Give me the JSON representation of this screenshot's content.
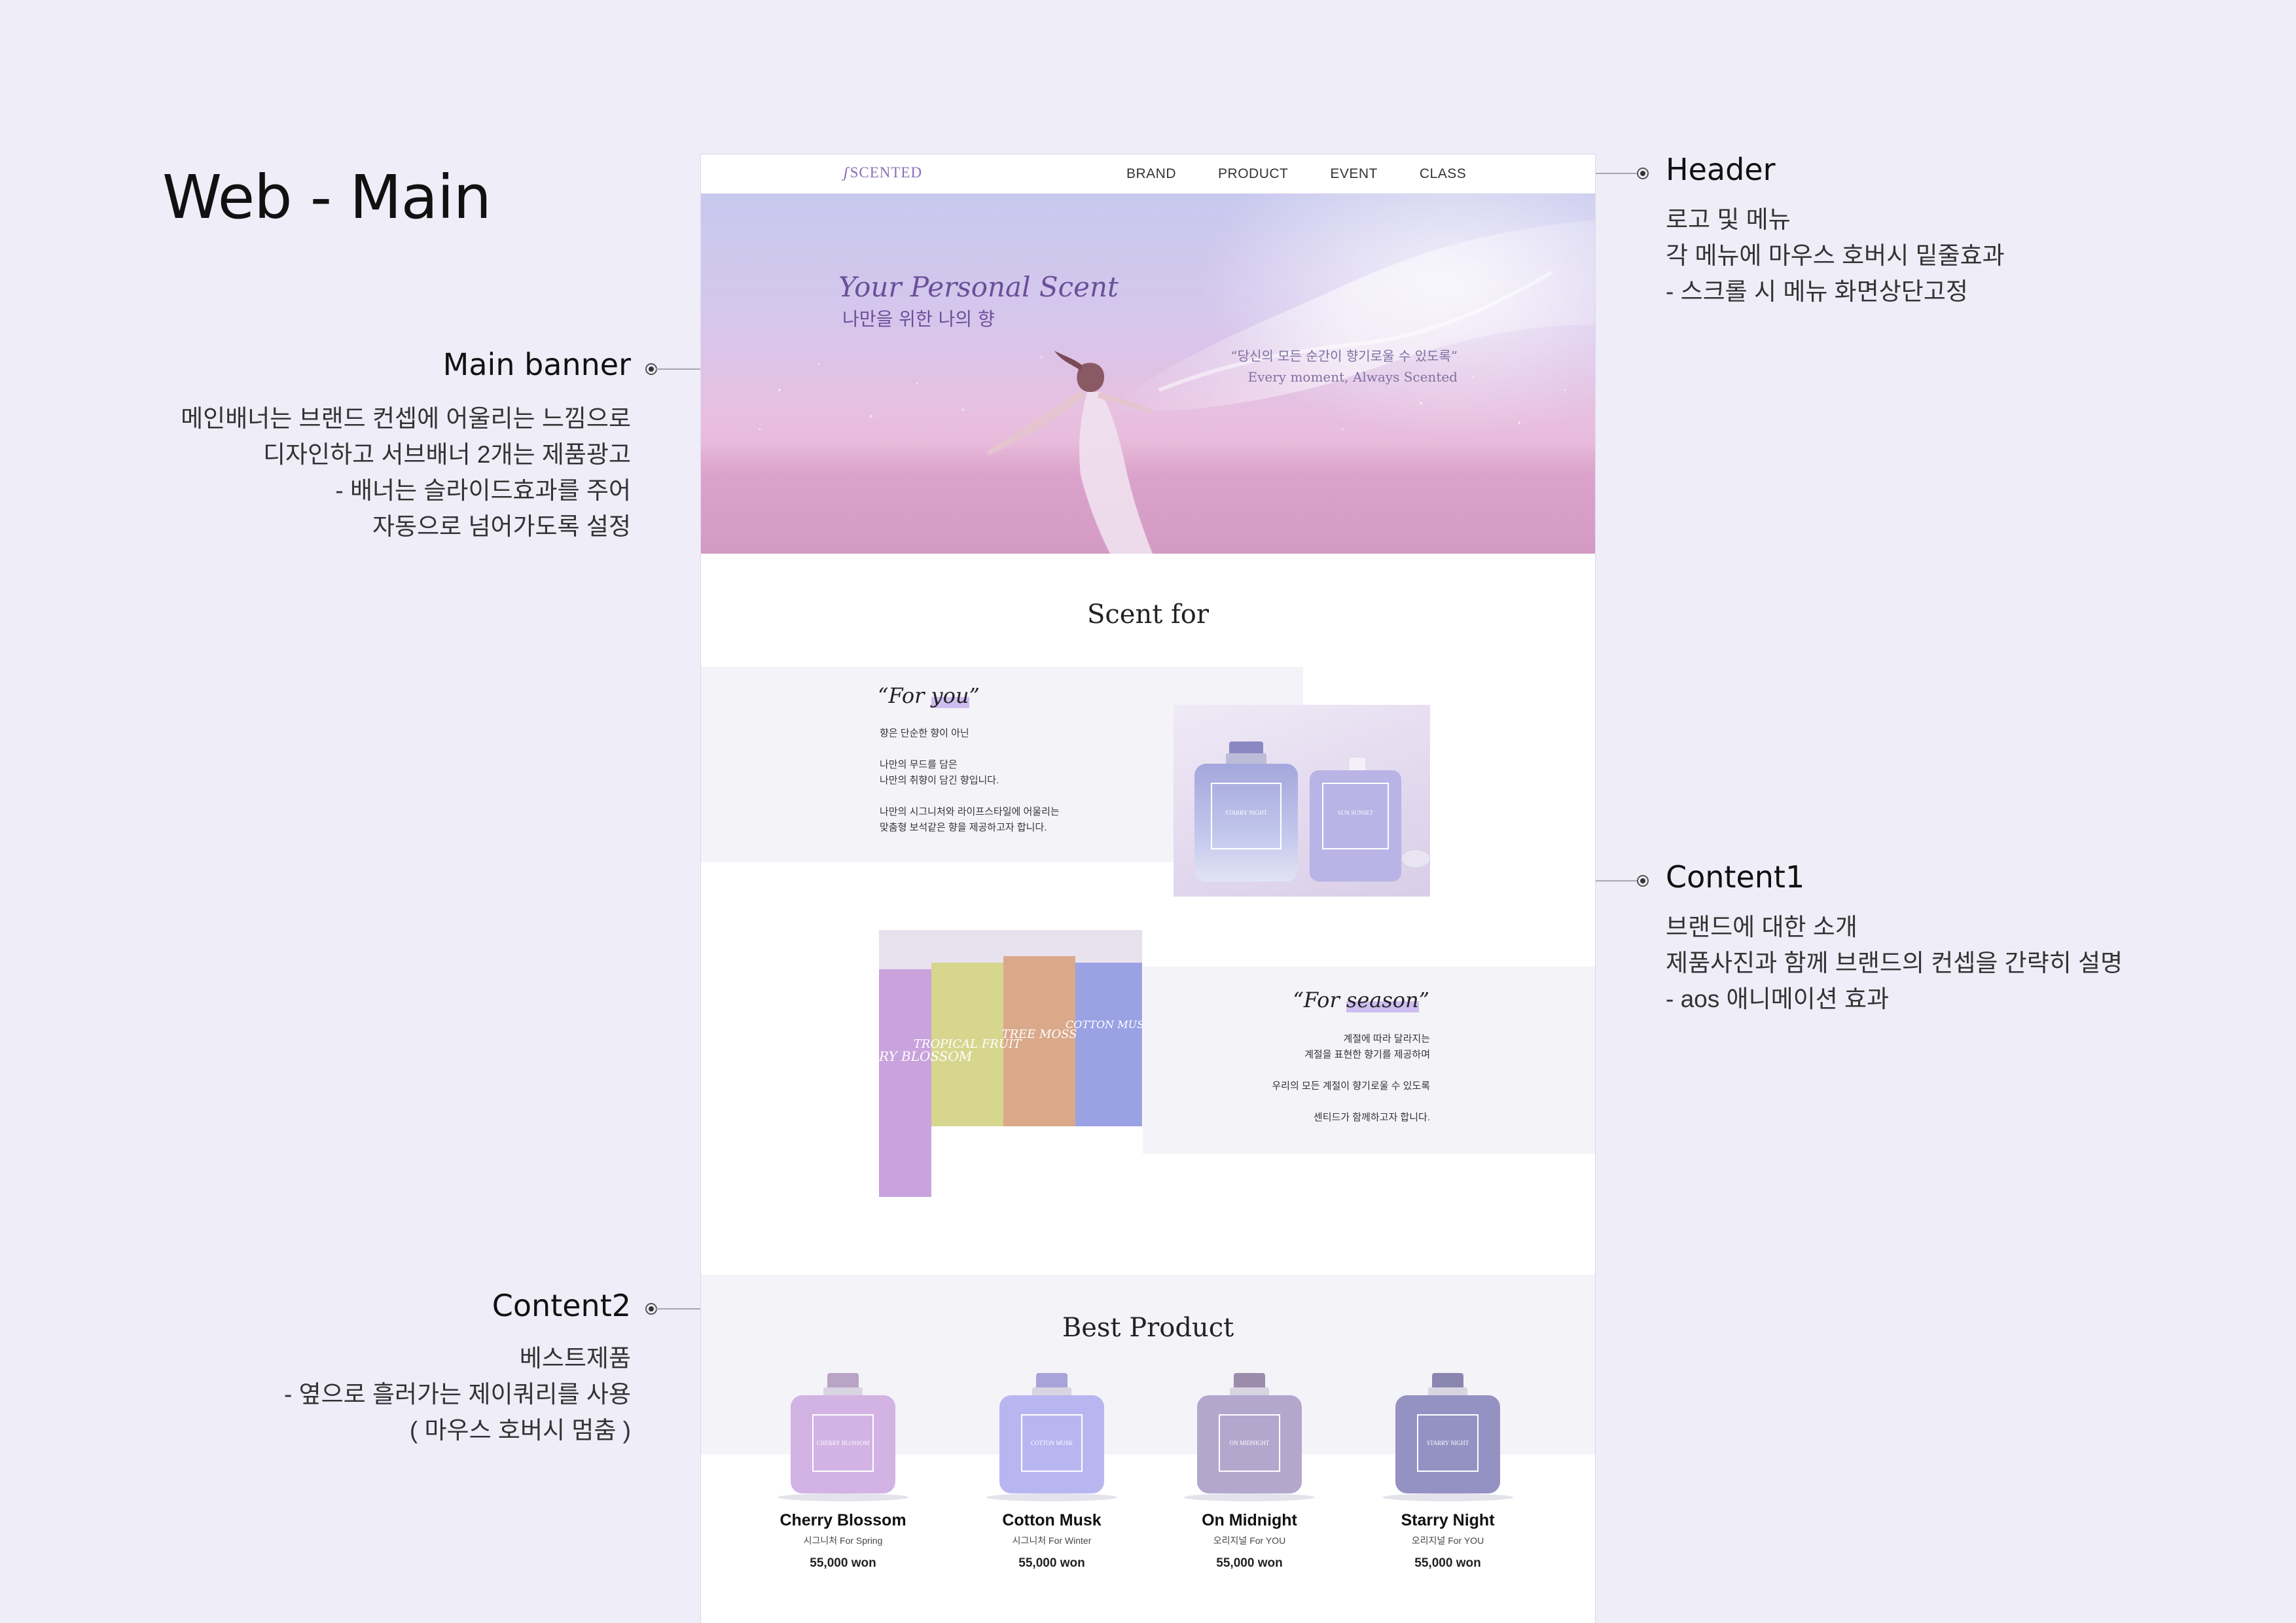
{
  "page": {
    "title": "Web - Main"
  },
  "annotations": {
    "header": {
      "title": "Header",
      "lines": [
        "로고 및 메뉴",
        "각 메뉴에 마우스 호버시 밑줄효과",
        "- 스크롤 시 메뉴 화면상단고정"
      ]
    },
    "main_banner": {
      "title": "Main banner",
      "lines": [
        "메인배너는 브랜드 컨셉에 어울리는 느낌으로",
        "디자인하고 서브배너 2개는 제품광고",
        "- 배너는 슬라이드효과를 주어",
        "자동으로 넘어가도록 설정"
      ]
    },
    "content1": {
      "title": "Content1",
      "lines": [
        "브랜드에 대한 소개",
        "제품사진과 함께 브랜드의 컨셉을 간략히 설명",
        "- aos 애니메이션 효과"
      ]
    },
    "content2": {
      "title": "Content2",
      "lines": [
        "베스트제품",
        "- 옆으로 흘러가는 제이쿼리를 사용",
        "( 마우스 호버시 멈춤 )"
      ]
    }
  },
  "site": {
    "logo": "SCENTED",
    "nav": [
      "BRAND",
      "PRODUCT",
      "EVENT",
      "CLASS"
    ],
    "banner": {
      "headline": "Your Personal Scent",
      "subheadline": "나만을 위한 나의 향",
      "quote_ko": "“당신의 모든 순간이 향기로울 수 있도록”",
      "quote_en": "Every moment, Always Scented"
    },
    "scent_for": {
      "title": "Scent for",
      "for_you": {
        "title_prefix": "“For ",
        "title_highlight": "you",
        "title_suffix": "”",
        "paragraphs": [
          "향은 단순한 향이 아닌",
          "나만의 무드를 담은",
          "나만의 취향이 담긴 향입니다.",
          "나만의 시그니처와 라이프스타일에 어울리는",
          "맞춤형 보석같은 향을 제공하고자 합니다."
        ]
      },
      "for_season": {
        "title_prefix": "“For ",
        "title_highlight": "season",
        "title_suffix": "”",
        "paragraphs": [
          "계절에 따라 달라지는",
          "계절을 표현한 향기를 제공하며",
          "우리의 모든 계절이 향기로울 수 있도록",
          "센티드가 함께하고자 합니다."
        ]
      },
      "bottle_labels": [
        "STARRY NIGHT",
        "SUN SUNSET"
      ],
      "box_labels": [
        "CHERRY BLOSSOM",
        "TROPICAL FRUIT",
        "TREE MOSS",
        "COTTON MUSK"
      ]
    },
    "best_product": {
      "title": "Best Product",
      "items": [
        {
          "name": "Cherry Blossom",
          "sub": "시그니처 For Spring",
          "price": "55,000 won",
          "label": "CHERRY BLOSSOM",
          "color": "#c9a3dd",
          "cap": "#b8a4c4"
        },
        {
          "name": "Cotton Musk",
          "sub": "시그니처 For Winter",
          "price": "55,000 won",
          "label": "COTTON MUSK",
          "color": "#a9a7ee",
          "cap": "#a8a3d8"
        },
        {
          "name": "On Midnight",
          "sub": "오리지널 For YOU",
          "price": "55,000 won",
          "label": "ON MIDNIGHT",
          "color": "#a494c2",
          "cap": "#9c8cac"
        },
        {
          "name": "Starry Night",
          "sub": "오리지널 For YOU",
          "price": "55,000 won",
          "label": "STARRY NIGHT",
          "color": "#7d7ab6",
          "cap": "#8a86b0"
        }
      ]
    }
  },
  "colors": {
    "background": "#efedf8",
    "accent": "#6b4f9a",
    "panel": "#f4f3f8"
  }
}
